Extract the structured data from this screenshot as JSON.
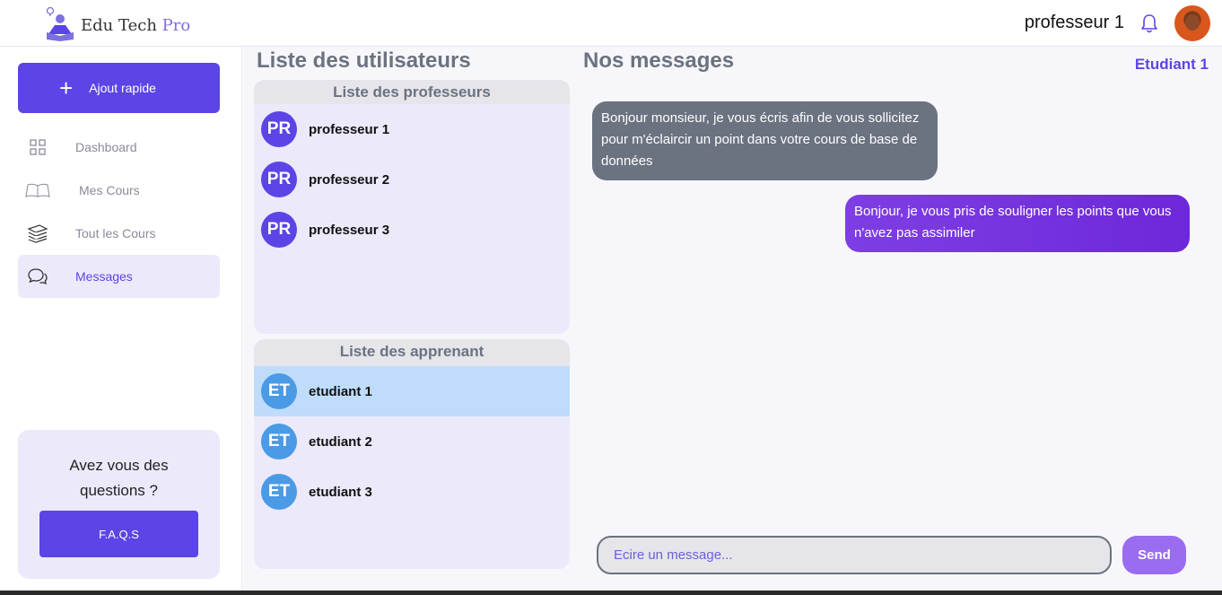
{
  "header": {
    "logo_name": "Edu Tech",
    "logo_suffix": "Pro",
    "user_name": "professeur 1",
    "icons": [
      "bell-icon",
      "user-avatar"
    ]
  },
  "sidebar": {
    "quick_add_label": "Ajout rapide",
    "items": [
      {
        "label": "Dashboard",
        "icon": "grid-icon"
      },
      {
        "label": "Mes Cours",
        "icon": "book-icon"
      },
      {
        "label": "Tout les Cours",
        "icon": "books-stack-icon"
      },
      {
        "label": "Messages",
        "icon": "chat-icon",
        "active": true
      }
    ],
    "faq_title": "Avez vous des questions ?",
    "faq_button": "F.A.Q.S"
  },
  "users": {
    "title": "Liste des utilisateurs",
    "professors_header": "Liste des professeurs",
    "professors": [
      {
        "badge": "PR",
        "name": "professeur 1"
      },
      {
        "badge": "PR",
        "name": "professeur 2"
      },
      {
        "badge": "PR",
        "name": "professeur 3"
      }
    ],
    "students_header": "Liste des apprenant",
    "students": [
      {
        "badge": "ET",
        "name": "etudiant 1",
        "selected": true
      },
      {
        "badge": "ET",
        "name": "etudiant 2"
      },
      {
        "badge": "ET",
        "name": "etudiant 3"
      }
    ]
  },
  "messages": {
    "title": "Nos messages",
    "chat_with": "Etudiant 1",
    "list": [
      {
        "direction": "incoming",
        "text": "Bonjour monsieur, je vous écris afin de vous sollicitez pour m'éclaircir un point dans votre cours de base de données"
      },
      {
        "direction": "outgoing",
        "text": "Bonjour, je vous pris de souligner les points que vous n'avez pas assimiler"
      }
    ],
    "input_placeholder": "Ecire un message...",
    "send_label": "Send"
  },
  "colors": {
    "accent": "#5b45e6",
    "student_badge": "#4a9ae6",
    "incoming_bubble": "#6b7280",
    "outgoing_bubble": "#7e3ee4",
    "selected_row": "#bfdcfb"
  }
}
